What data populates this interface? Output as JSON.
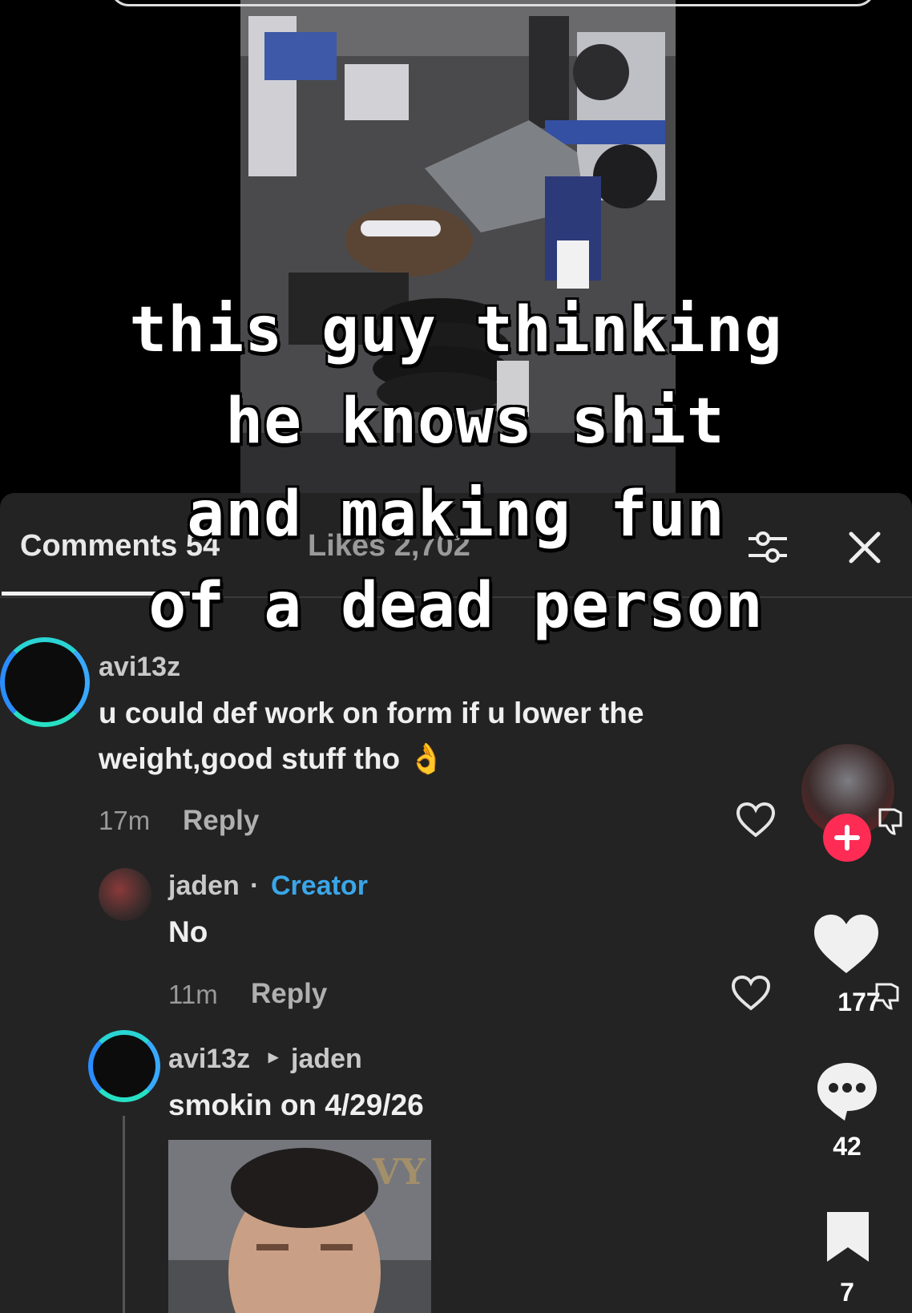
{
  "overlay_caption": [
    "this guy thinking",
    " he knows shit",
    "and making fun",
    "of a dead person"
  ],
  "tabs": {
    "comments_label": "Comments 54",
    "likes_label": "Likes 2,702"
  },
  "comments": [
    {
      "username": "avi13z",
      "text_line1": "u could def work on form if u lower the",
      "text_line2": "weight,good stuff tho 👌",
      "time": "17m",
      "reply": "Reply"
    },
    {
      "username": "jaden",
      "separator": "·",
      "badge": "Creator",
      "text": "No",
      "time": "11m",
      "reply": "Reply"
    },
    {
      "username": "avi13z",
      "arrow": "▸",
      "reply_to": "jaden",
      "text": "smokin on 4/29/26"
    }
  ],
  "sidebar": {
    "likes": "177",
    "comments": "42",
    "saves": "7"
  },
  "colors": {
    "panel": "#232323",
    "follow_plus": "#fe2c55",
    "creator_badge": "#3aa6e8"
  },
  "icons": [
    "filter-icon",
    "close-icon",
    "heart-outline-icon",
    "heart-icon",
    "comment-bubble-icon",
    "bookmark-icon",
    "plus-icon",
    "dislike-icon"
  ]
}
